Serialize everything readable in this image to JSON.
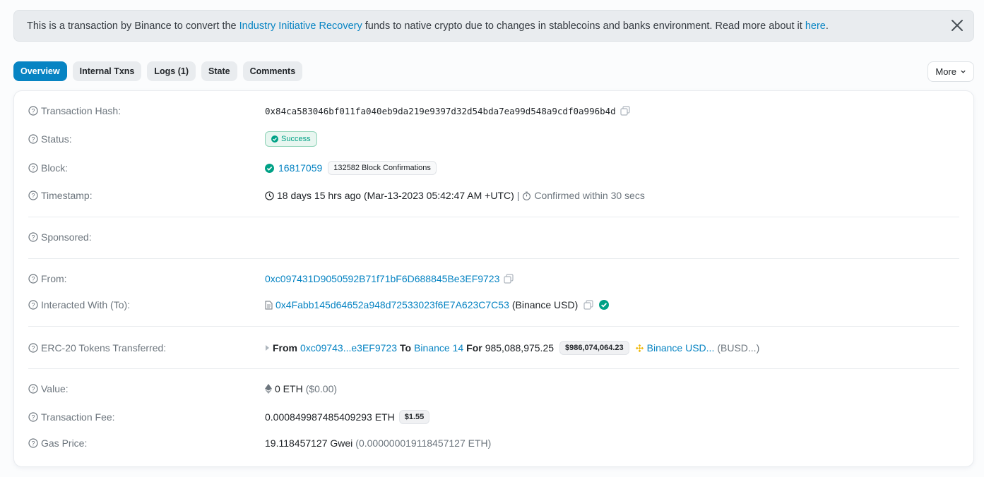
{
  "banner": {
    "text_before": "This is a transaction by Binance to convert the ",
    "link_text": "Industry Initiative Recovery",
    "text_middle": " funds to native crypto due to changes in stablecoins and banks environment. Read more about it ",
    "here_link": "here",
    "text_end": "."
  },
  "tabs": [
    {
      "label": "Overview",
      "active": true
    },
    {
      "label": "Internal Txns"
    },
    {
      "label": "Logs (1)"
    },
    {
      "label": "State"
    },
    {
      "label": "Comments"
    }
  ],
  "more_label": "More",
  "tx": {
    "hash_label": "Transaction Hash:",
    "hash": "0x84ca583046bf011fa040eb9da219e9397d32d54bda7ea99d548a9cdf0a996b4d",
    "status_label": "Status:",
    "status": "Success",
    "block_label": "Block:",
    "block": "16817059",
    "confirmations": "132582 Block Confirmations",
    "timestamp_label": "Timestamp:",
    "timestamp": "18 days 15 hrs ago (Mar-13-2023 05:42:47 AM +UTC)",
    "separator": "|",
    "confirmed_within": "Confirmed within 30 secs",
    "sponsored_label": "Sponsored:",
    "from_label": "From:",
    "from": "0xc097431D9050592B71f71bF6D688845Be3EF9723",
    "to_label": "Interacted With (To):",
    "to": "0x4Fabb145d64652a948d72533023f6E7A623C7C53",
    "to_name": "(Binance USD)",
    "erc20_label": "ERC-20 Tokens Transferred:",
    "erc20": {
      "from_word": "From",
      "from": "0xc09743...e3EF9723",
      "to_word": "To",
      "to": "Binance 14",
      "for_word": "For",
      "amount": "985,088,975.25",
      "usd": "$986,074,064.23",
      "token": "Binance USD...",
      "symbol": "(BUSD...)"
    },
    "value_label": "Value:",
    "value": "0 ETH",
    "value_usd": "($0.00)",
    "fee_label": "Transaction Fee:",
    "fee": "0.000849987485409293 ETH",
    "fee_usd": "$1.55",
    "gas_label": "Gas Price:",
    "gas": "19.118457127 Gwei",
    "gas_eth": "(0.000000019118457127 ETH)"
  },
  "colors": {
    "accent": "#0784c3",
    "success": "#00a186",
    "token": "#f0b90b"
  }
}
